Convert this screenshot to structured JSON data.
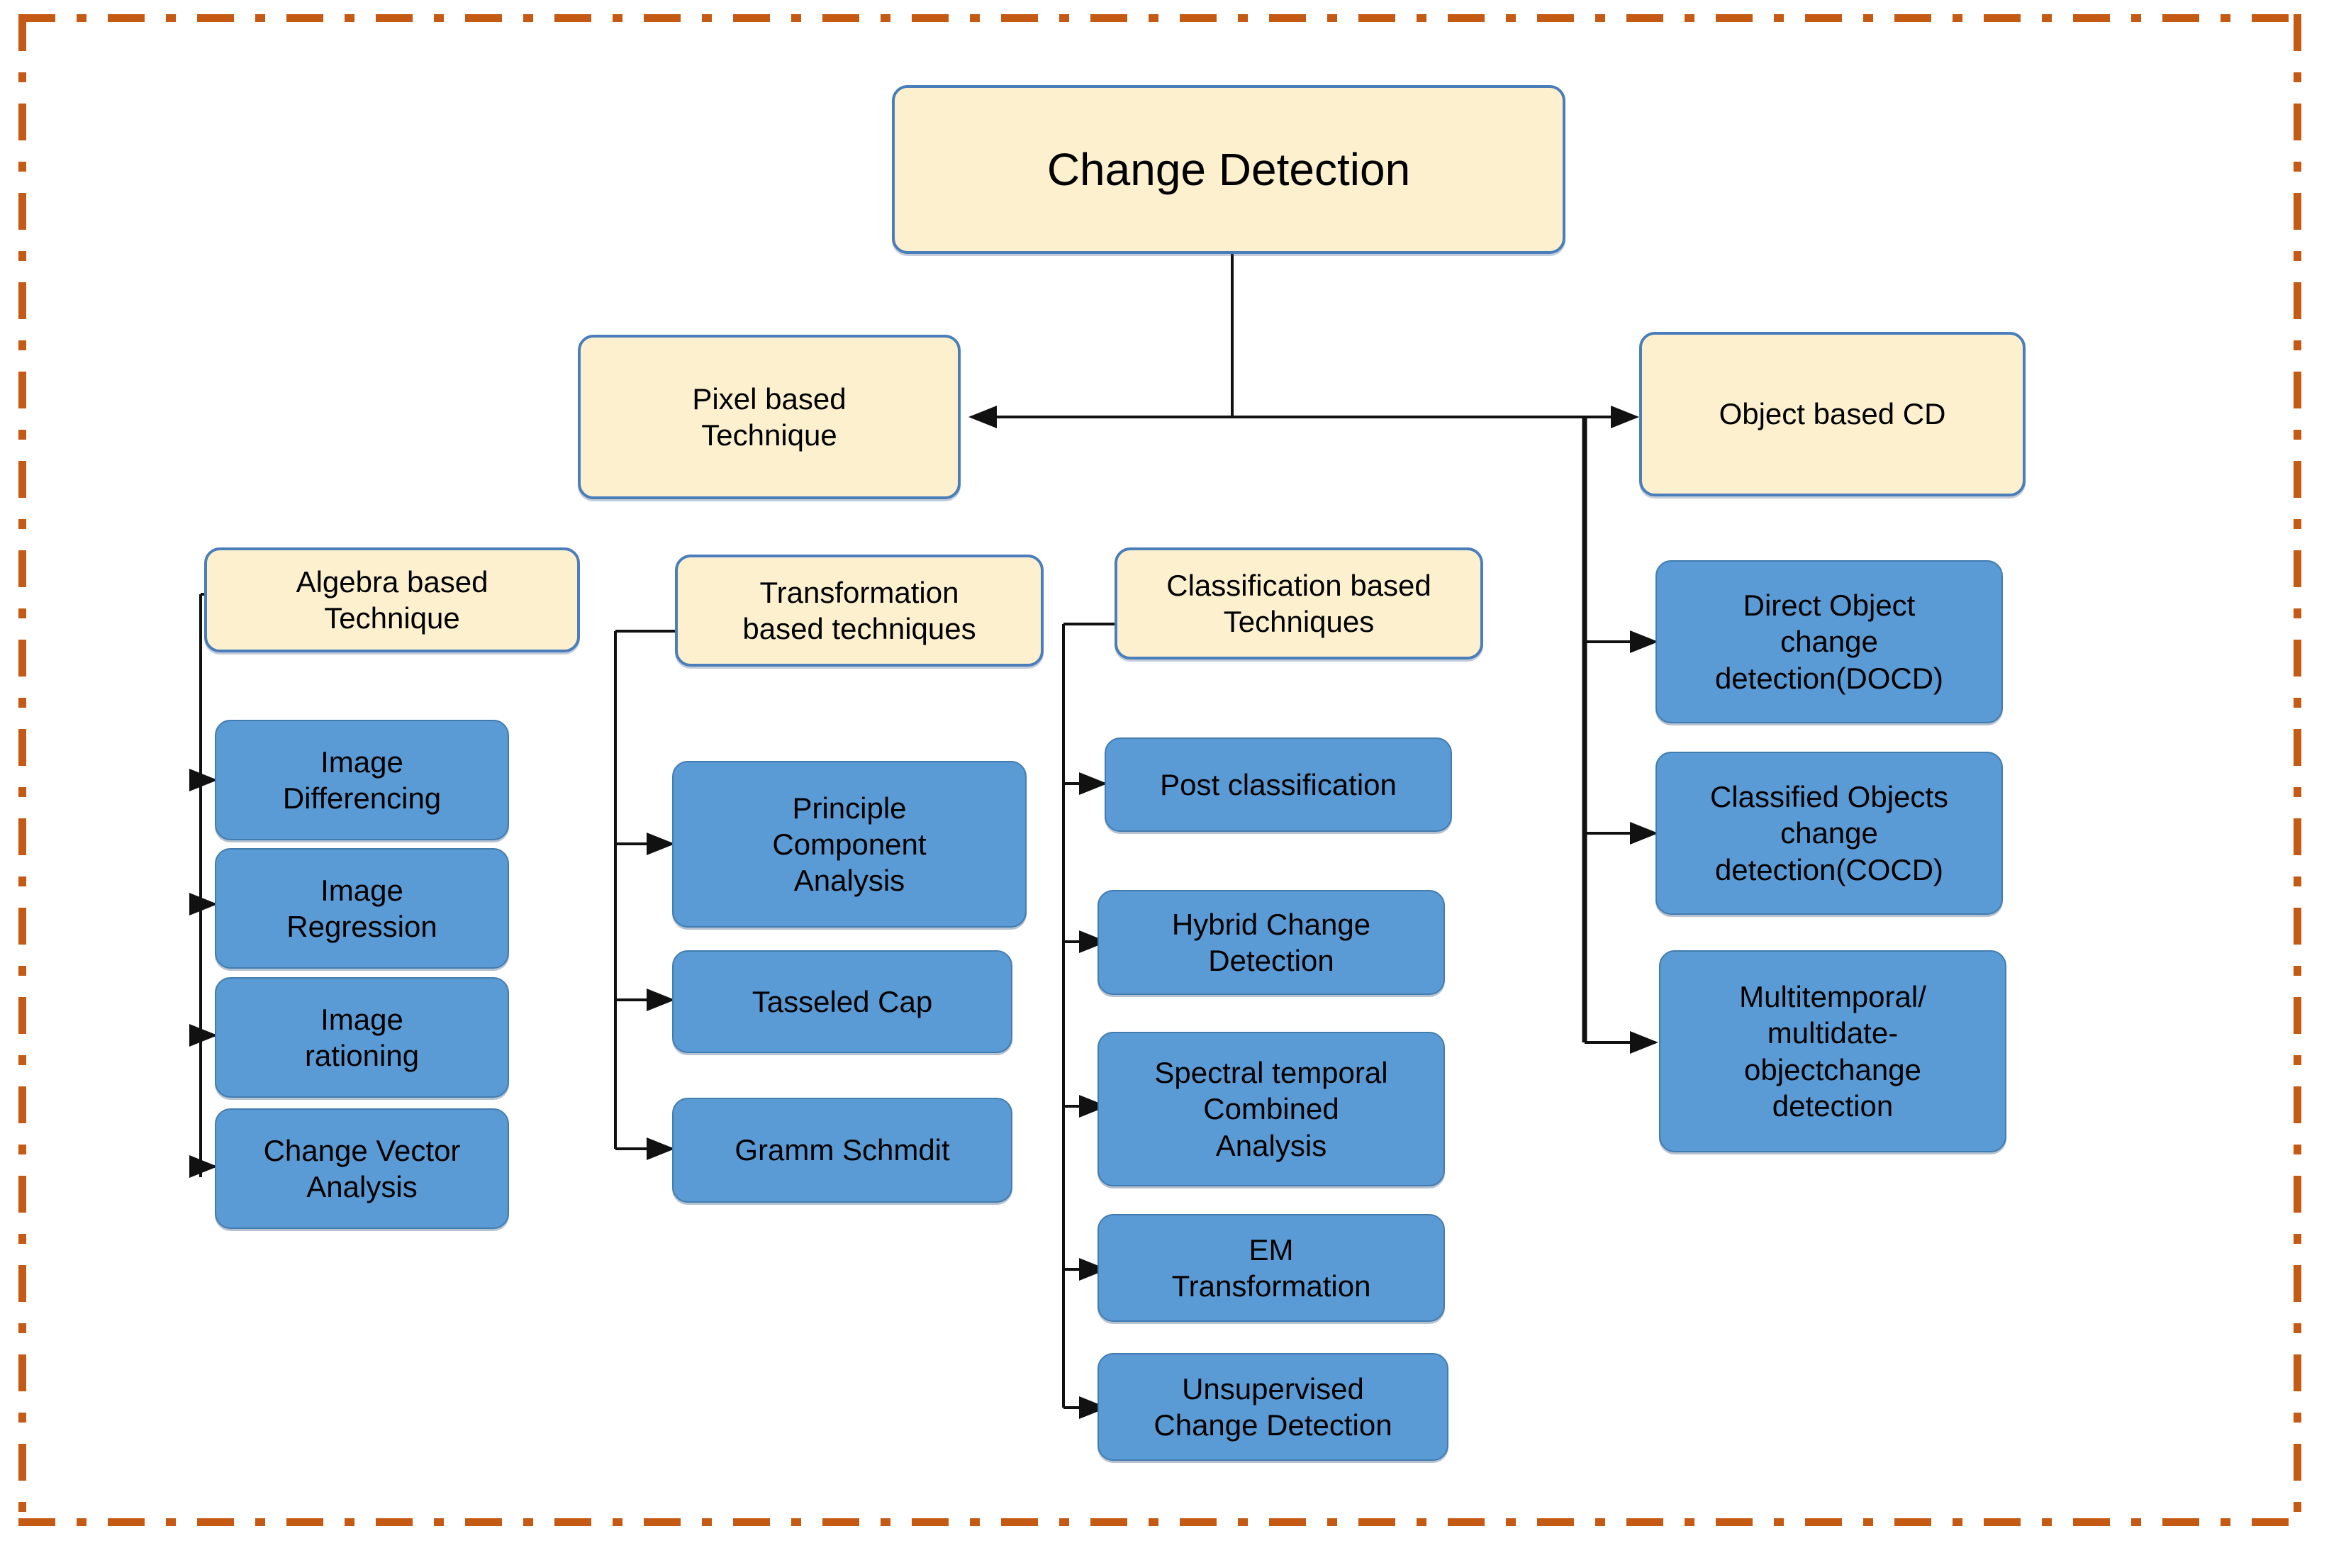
{
  "diagram": {
    "title": "Change Detection",
    "frame_color": "#C55A14",
    "category_color": "#FDF0CE",
    "leaf_color": "#5B9BD5",
    "border_color": "#4A7EBB"
  },
  "nodes": {
    "root": "Change Detection",
    "pixel_based": "Pixel based\nTechnique",
    "object_based": "Object based CD",
    "algebra_header": "Algebra based\nTechnique",
    "transformation_header": "Transformation\nbased techniques",
    "classification_header": "Classification based\nTechniques"
  },
  "algebra_children": [
    "Image\nDifferencing",
    "Image\nRegression",
    "Image\nrationing",
    "Change Vector\nAnalysis"
  ],
  "transformation_children": [
    "Principle\nComponent\nAnalysis",
    "Tasseled Cap",
    "Gramm Schmdit"
  ],
  "classification_children": [
    "Post classification",
    "Hybrid Change\nDetection",
    "Spectral temporal\nCombined\nAnalysis",
    "EM\nTransformation",
    "Unsupervised\nChange Detection"
  ],
  "object_children": [
    "Direct Object\nchange\ndetection(DOCD)",
    "Classified Objects\nchange\ndetection(COCD)",
    "Multitemporal/\nmultidate-\nobjectchange\ndetection"
  ]
}
